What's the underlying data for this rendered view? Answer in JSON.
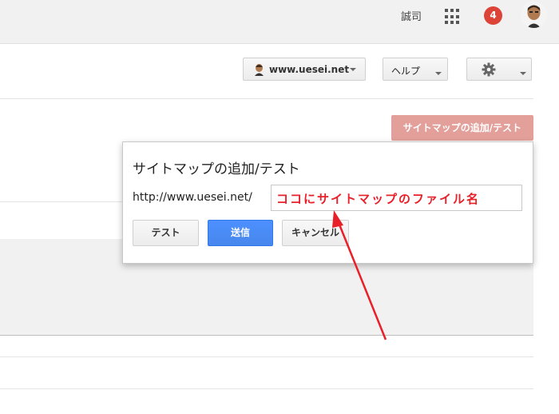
{
  "top_bar": {
    "user_name": "誠司",
    "notification_count": "4"
  },
  "toolbar": {
    "site_label": "www.uesei.net",
    "help_label": "ヘルプ"
  },
  "add_sitemap_button_label": "サイトマップの追加/テスト",
  "dialog": {
    "title": "サイトマップの追加/テスト",
    "url_prefix": "http://www.uesei.net/",
    "input_value": "ココにサイトマップのファイル名",
    "buttons": {
      "test": "テスト",
      "send": "送信",
      "cancel": "キャンセル"
    }
  },
  "annotation": {
    "color": "#e8202a"
  }
}
